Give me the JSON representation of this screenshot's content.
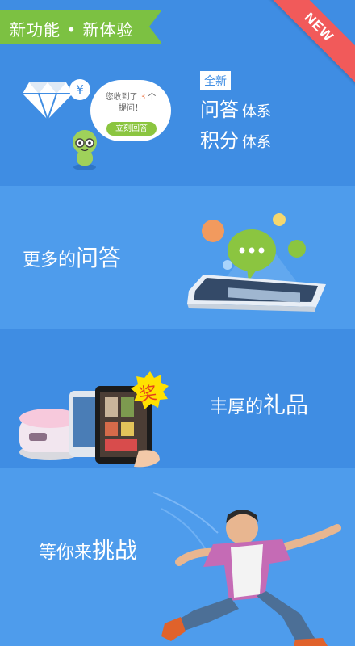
{
  "ribbon": {
    "title": "新功能 • 新体验"
  },
  "badge": {
    "label": "NEW"
  },
  "panel1": {
    "yen": "¥",
    "bubble": {
      "line1_a": "您收到了",
      "count": "3",
      "line1_b": "个",
      "line2": "提问！",
      "button": "立刻回答"
    },
    "tag": "全新",
    "line1_main": "问答",
    "line1_sub": "体系",
    "line2_main": "积分",
    "line2_sub": "体系"
  },
  "panel2": {
    "small": "更多的",
    "big": "问答"
  },
  "panel3": {
    "small": "丰厚的",
    "big": "礼品",
    "prize": "奖"
  },
  "panel4": {
    "small": "等你来",
    "big": "挑战"
  },
  "colors": {
    "blue": "#3f8de3",
    "blue_light": "#4e9cec",
    "green": "#7cc142",
    "red": "#f15a5a",
    "yellow": "#ffe100"
  }
}
